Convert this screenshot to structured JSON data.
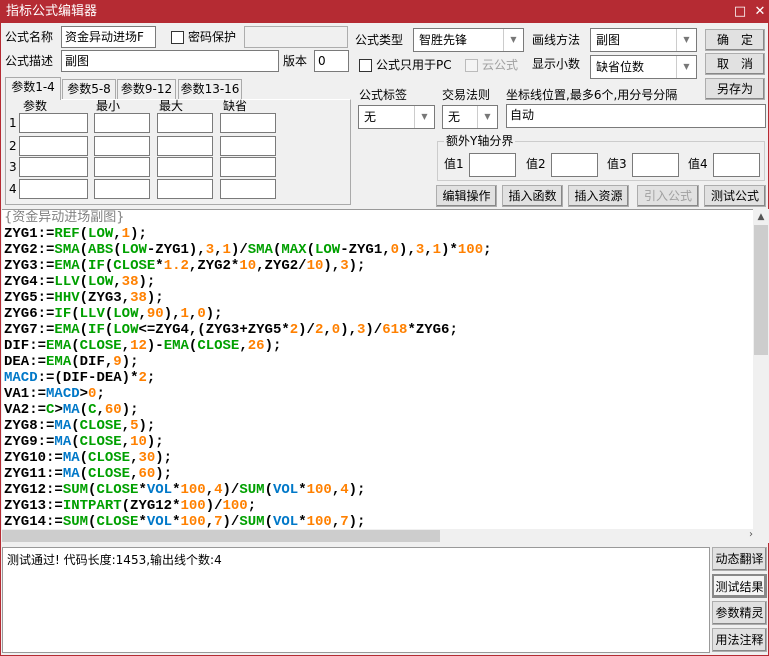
{
  "window": {
    "title": "指标公式编辑器",
    "minimize": "□",
    "close": "✕"
  },
  "form": {
    "name_label": "公式名称",
    "name_value": "资金异动进场F",
    "password_label": "密码保护",
    "password_checked": false,
    "password_value": "",
    "desc_label": "公式描述",
    "desc_value": "副图",
    "version_label": "版本",
    "version_value": "0",
    "type_label": "公式类型",
    "type_value": "智胜先锋",
    "draw_label": "画线方法",
    "draw_value": "副图",
    "pc_only_label": "公式只用于PC",
    "pc_only_checked": false,
    "cloud_label": "云公式",
    "cloud_checked": false,
    "decimal_label": "显示小数",
    "decimal_value": "缺省位数",
    "tag_label": "公式标签",
    "tag_value": "无",
    "rule_label": "交易法则",
    "rule_value": "无",
    "axis_label": "坐标线位置,最多6个,用分号分隔",
    "axis_value": "自动",
    "yaxis_group": "额外Y轴分界",
    "yvals": [
      {
        "label": "值1",
        "value": ""
      },
      {
        "label": "值2",
        "value": ""
      },
      {
        "label": "值3",
        "value": ""
      },
      {
        "label": "值4",
        "value": ""
      }
    ]
  },
  "buttons": {
    "ok": "确　定",
    "cancel": "取　消",
    "save_as": "另存为",
    "edit_ops": "编辑操作",
    "insert_func": "插入函数",
    "insert_res": "插入资源",
    "import_formula": "引入公式",
    "test_formula": "测试公式"
  },
  "param_tabs": [
    "参数1-4",
    "参数5-8",
    "参数9-12",
    "参数13-16"
  ],
  "param_headers": [
    "参数",
    "最小",
    "最大",
    "缺省"
  ],
  "param_rows": [
    "1",
    "2",
    "3",
    "4"
  ],
  "syntax": {
    "green": [
      "REF",
      "LOW",
      "SMA",
      "ABS",
      "MAX",
      "EMA",
      "IF",
      "CLOSE",
      "LLV",
      "HHV",
      "C",
      "SUM",
      "INTPART"
    ],
    "blue": [
      "MA",
      "MACD",
      "VOL"
    ],
    "colors": {
      "keyword": "#00a000",
      "number": "#ff8000",
      "builtin": "#0078c8",
      "comment": "#808080"
    }
  },
  "code_lines": [
    "{资金异动进场副图}",
    "ZYG1:=REF(LOW,1);",
    "ZYG2:=SMA(ABS(LOW-ZYG1),3,1)/SMA(MAX(LOW-ZYG1,0),3,1)*100;",
    "ZYG3:=EMA(IF(CLOSE*1.2,ZYG2*10,ZYG2/10),3);",
    "ZYG4:=LLV(LOW,38);",
    "ZYG5:=HHV(ZYG3,38);",
    "ZYG6:=IF(LLV(LOW,90),1,0);",
    "ZYG7:=EMA(IF(LOW<=ZYG4,(ZYG3+ZYG5*2)/2,0),3)/618*ZYG6;",
    "DIF:=EMA(CLOSE,12)-EMA(CLOSE,26);",
    "DEA:=EMA(DIF,9);",
    "MACD:=(DIF-DEA)*2;",
    "VA1:=MACD>0;",
    "VA2:=C>MA(C,60);",
    "ZYG8:=MA(CLOSE,5);",
    "ZYG9:=MA(CLOSE,10);",
    "ZYG10:=MA(CLOSE,30);",
    "ZYG11:=MA(CLOSE,60);",
    "ZYG12:=SUM(CLOSE*VOL*100,4)/SUM(VOL*100,4);",
    "ZYG13:=INTPART(ZYG12*100)/100;",
    "ZYG14:=SUM(CLOSE*VOL*100,7)/SUM(VOL*100,7);"
  ],
  "output": {
    "text": "测试通过! 代码长度:1453,输出线个数:4"
  },
  "side_buttons": [
    {
      "label": "动态翻译",
      "active": false
    },
    {
      "label": "测试结果",
      "active": true
    },
    {
      "label": "参数精灵",
      "active": false
    },
    {
      "label": "用法注释",
      "active": false
    }
  ]
}
